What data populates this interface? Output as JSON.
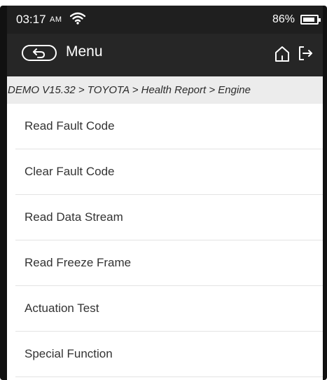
{
  "status_bar": {
    "time": "03:17",
    "ampm": "AM",
    "battery": "86%"
  },
  "header": {
    "title": "Menu"
  },
  "breadcrumb": "DEMO V15.32 > TOYOTA > Health Report > Engine",
  "menu": {
    "items": [
      {
        "label": "Read Fault Code"
      },
      {
        "label": "Clear Fault Code"
      },
      {
        "label": "Read Data Stream"
      },
      {
        "label": "Read Freeze Frame"
      },
      {
        "label": "Actuation Test"
      },
      {
        "label": "Special Function"
      }
    ]
  },
  "colors": {
    "statusbar_bg": "#1f1f1f",
    "navbar_bg": "#262626",
    "breadcrumb_bg": "#ececec"
  }
}
